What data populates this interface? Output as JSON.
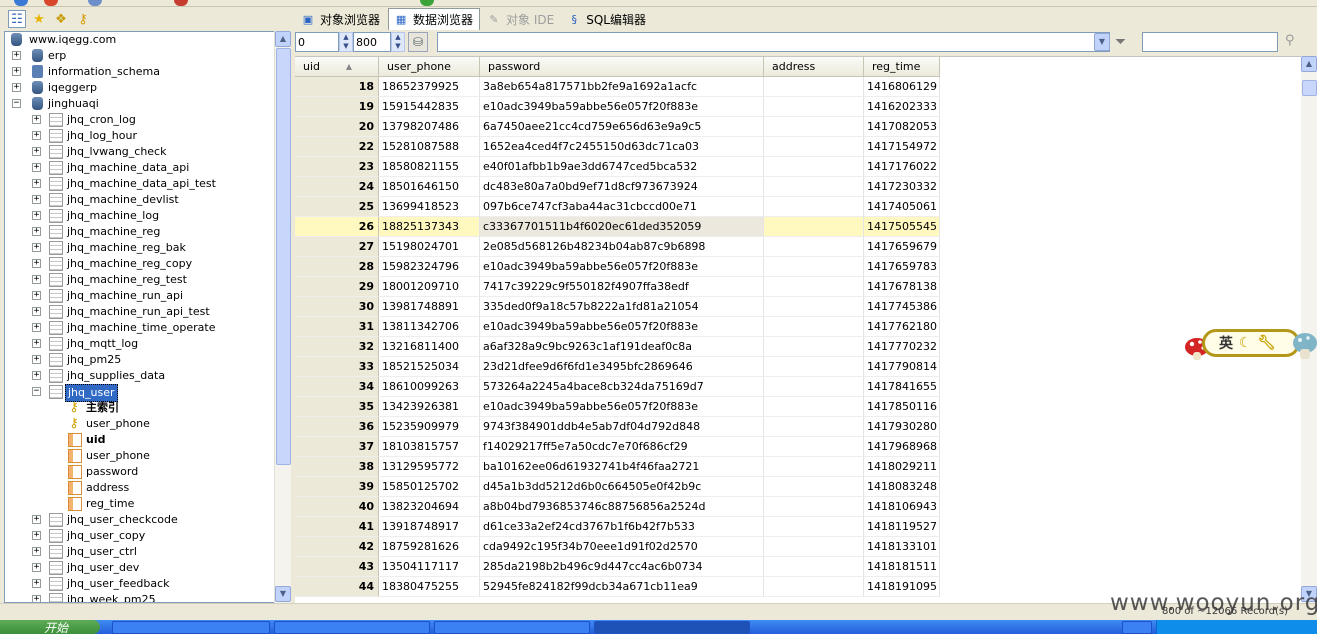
{
  "tabs": [
    {
      "label": "对象浏览器",
      "icon": "object-browser-icon"
    },
    {
      "label": "数据浏览器",
      "icon": "data-browser-icon"
    },
    {
      "label": "对象 IDE",
      "icon": "object-ide-icon"
    },
    {
      "label": "SQL编辑器",
      "icon": "sql-editor-icon"
    }
  ],
  "tree": {
    "root": "www.iqegg.com",
    "databases": [
      "erp",
      "information_schema",
      "iqeggerp",
      "jinghuaqi"
    ],
    "tables_before": [
      "jhq_cron_log",
      "jhq_log_hour",
      "jhq_lvwang_check",
      "jhq_machine_data_api",
      "jhq_machine_data_api_test",
      "jhq_machine_devlist",
      "jhq_machine_log",
      "jhq_machine_reg",
      "jhq_machine_reg_bak",
      "jhq_machine_reg_copy",
      "jhq_machine_reg_test",
      "jhq_machine_run_api",
      "jhq_machine_run_api_test",
      "jhq_machine_time_operate",
      "jhq_mqtt_log",
      "jhq_pm25",
      "jhq_supplies_data"
    ],
    "selected_table": "jhq_user",
    "indexes": [
      "主索引",
      "user_phone"
    ],
    "columns": [
      "uid",
      "user_phone",
      "password",
      "address",
      "reg_time"
    ],
    "tables_after": [
      "jhq_user_checkcode",
      "jhq_user_copy",
      "jhq_user_ctrl",
      "jhq_user_dev",
      "jhq_user_feedback",
      "jhq_week_pm25"
    ]
  },
  "grid_toolbar": {
    "offset": "0",
    "limit": "800",
    "filter": "",
    "search": ""
  },
  "grid": {
    "columns": [
      "uid",
      "user_phone",
      "password",
      "address",
      "reg_time"
    ],
    "current_row_uid": "26",
    "rows": [
      [
        "18",
        "18652379925",
        "3a8eb654a817571bb2fe9a1692a1acfc",
        "",
        "1416806129"
      ],
      [
        "19",
        "15915442835",
        "e10adc3949ba59abbe56e057f20f883e",
        "",
        "1416202333"
      ],
      [
        "20",
        "13798207486",
        "6a7450aee21cc4cd759e656d63e9a9c5",
        "",
        "1417082053"
      ],
      [
        "22",
        "15281087588",
        "1652ea4ced4f7c2455150d63dc71ca03",
        "",
        "1417154972"
      ],
      [
        "23",
        "18580821155",
        "e40f01afbb1b9ae3dd6747ced5bca532",
        "",
        "1417176022"
      ],
      [
        "24",
        "18501646150",
        "dc483e80a7a0bd9ef71d8cf973673924",
        "",
        "1417230332"
      ],
      [
        "25",
        "13699418523",
        "097b6ce747cf3aba44ac31cbccd00e71",
        "",
        "1417405061"
      ],
      [
        "26",
        "18825137343",
        "c33367701511b4f6020ec61ded352059",
        "",
        "1417505545"
      ],
      [
        "27",
        "15198024701",
        "2e085d568126b48234b04ab87c9b6898",
        "",
        "1417659679"
      ],
      [
        "28",
        "15982324796",
        "e10adc3949ba59abbe56e057f20f883e",
        "",
        "1417659783"
      ],
      [
        "29",
        "18001209710",
        "7417c39229c9f550182f4907ffa38edf",
        "",
        "1417678138"
      ],
      [
        "30",
        "13981748891",
        "335ded0f9a18c57b8222a1fd81a21054",
        "",
        "1417745386"
      ],
      [
        "31",
        "13811342706",
        "e10adc3949ba59abbe56e057f20f883e",
        "",
        "1417762180"
      ],
      [
        "32",
        "13216811400",
        "a6af328a9c9bc9263c1af191deaf0c8a",
        "",
        "1417770232"
      ],
      [
        "33",
        "18521525034",
        "23d21dfee9d6f6fd1e3495bfc2869646",
        "",
        "1417790814"
      ],
      [
        "34",
        "18610099263",
        "573264a2245a4bace8cb324da75169d7",
        "",
        "1417841655"
      ],
      [
        "35",
        "13423926381",
        "e10adc3949ba59abbe56e057f20f883e",
        "",
        "1417850116"
      ],
      [
        "36",
        "15235909979",
        "9743f384901ddb4e5ab7df04d792d848",
        "",
        "1417930280"
      ],
      [
        "37",
        "18103815757",
        "f14029217ff5e7a50cdc7e70f686cf29",
        "",
        "1417968968"
      ],
      [
        "38",
        "13129595772",
        "ba10162ee06d61932741b4f46faa2721",
        "",
        "1418029211"
      ],
      [
        "39",
        "15850125702",
        "d45a1b3dd5212d6b0c664505e0f42b9c",
        "",
        "1418083248"
      ],
      [
        "40",
        "13823204694",
        "a8b04bd7936853746c88756856a2524d",
        "",
        "1418106943"
      ],
      [
        "41",
        "13918748917",
        "d61ce33a2ef24cd3767b1f6b42f7b533",
        "",
        "1418119527"
      ],
      [
        "42",
        "18759281626",
        "cda9492c195f34b70eee1d91f02d2570",
        "",
        "1418133101"
      ],
      [
        "43",
        "13504117117",
        "285da2198b2b496c9d447cc4ac6b0734",
        "",
        "1418181511"
      ],
      [
        "44",
        "18380475255",
        "52945fe824182f99dcb34a671cb11ea9",
        "",
        "1418191095"
      ]
    ]
  },
  "status": {
    "records": "800 of ~12066 Record(s)"
  },
  "watermark": "www.wooyun.org",
  "ime": {
    "mode": "英"
  },
  "taskbar": {
    "start": "开始",
    "items": [
      "",
      "",
      "",
      "",
      ""
    ]
  }
}
